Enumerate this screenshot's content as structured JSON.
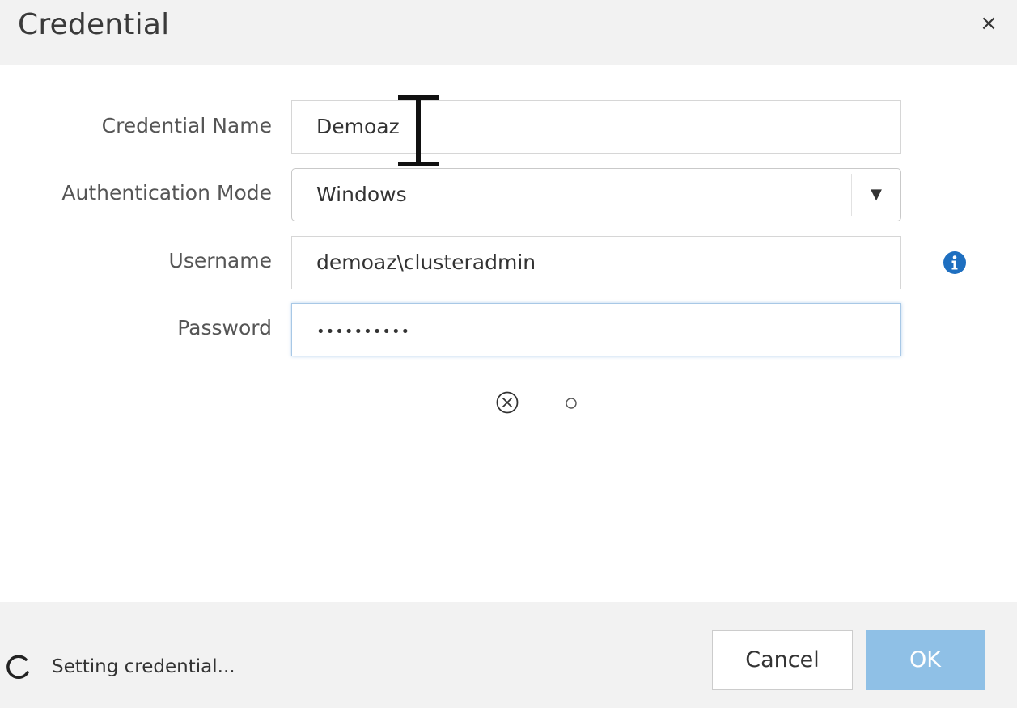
{
  "dialog": {
    "title": "Credential",
    "close_symbol": "×"
  },
  "form": {
    "credential_name": {
      "label": "Credential Name",
      "value": "Demoaz"
    },
    "authentication_mode": {
      "label": "Authentication Mode",
      "selected": "Windows",
      "arrow_symbol": "▼"
    },
    "username": {
      "label": "Username",
      "value": "demoaz\\clusteradmin",
      "info_icon": "info-icon"
    },
    "password": {
      "label": "Password",
      "masked_value": "••••••••••"
    }
  },
  "validation": {
    "icons": [
      "error-circle-icon",
      "pending-circle-icon"
    ]
  },
  "footer": {
    "status_text": "Setting credential...",
    "cancel_label": "Cancel",
    "ok_label": "OK"
  },
  "colors": {
    "title_bar_bg": "#f2f2f2",
    "ok_button_bg": "#8fc0e6",
    "info_icon": "#1e6fc0",
    "focus_border": "#a8c8e6"
  }
}
